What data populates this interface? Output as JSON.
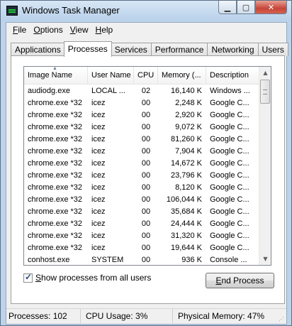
{
  "window": {
    "title": "Windows Task Manager"
  },
  "menu": [
    {
      "key": "F",
      "rest": "ile"
    },
    {
      "key": "O",
      "rest": "ptions"
    },
    {
      "key": "V",
      "rest": "iew"
    },
    {
      "key": "H",
      "rest": "elp"
    }
  ],
  "tabs": [
    {
      "label": "Applications",
      "active": false
    },
    {
      "label": "Processes",
      "active": true
    },
    {
      "label": "Services",
      "active": false
    },
    {
      "label": "Performance",
      "active": false
    },
    {
      "label": "Networking",
      "active": false
    },
    {
      "label": "Users",
      "active": false
    }
  ],
  "processes": {
    "columns": [
      "Image Name",
      "User Name",
      "CPU",
      "Memory (...",
      "Description"
    ],
    "sorted_column": "Image Name",
    "rows": [
      [
        "audiodg.exe",
        "LOCAL ...",
        "02",
        "16,140 K",
        "Windows ..."
      ],
      [
        "chrome.exe *32",
        "icez",
        "00",
        "2,248 K",
        "Google C..."
      ],
      [
        "chrome.exe *32",
        "icez",
        "00",
        "2,920 K",
        "Google C..."
      ],
      [
        "chrome.exe *32",
        "icez",
        "00",
        "9,072 K",
        "Google C..."
      ],
      [
        "chrome.exe *32",
        "icez",
        "00",
        "81,260 K",
        "Google C..."
      ],
      [
        "chrome.exe *32",
        "icez",
        "00",
        "7,904 K",
        "Google C..."
      ],
      [
        "chrome.exe *32",
        "icez",
        "00",
        "14,672 K",
        "Google C..."
      ],
      [
        "chrome.exe *32",
        "icez",
        "00",
        "23,796 K",
        "Google C..."
      ],
      [
        "chrome.exe *32",
        "icez",
        "00",
        "8,120 K",
        "Google C..."
      ],
      [
        "chrome.exe *32",
        "icez",
        "00",
        "106,044 K",
        "Google C..."
      ],
      [
        "chrome.exe *32",
        "icez",
        "00",
        "35,684 K",
        "Google C..."
      ],
      [
        "chrome.exe *32",
        "icez",
        "00",
        "24,444 K",
        "Google C..."
      ],
      [
        "chrome.exe *32",
        "icez",
        "00",
        "31,320 K",
        "Google C..."
      ],
      [
        "chrome.exe *32",
        "icez",
        "00",
        "19,644 K",
        "Google C..."
      ],
      [
        "conhost.exe",
        "SYSTEM",
        "00",
        "936 K",
        "Console ..."
      ]
    ]
  },
  "options": {
    "show_all_users_key": "S",
    "show_all_users_rest": "how processes from all users",
    "show_all_users_checked": true
  },
  "end_process": {
    "key": "E",
    "rest": "nd Process"
  },
  "status": {
    "processes": "Processes: 102",
    "cpu": "CPU Usage: 3%",
    "memory": "Physical Memory: 47%"
  }
}
